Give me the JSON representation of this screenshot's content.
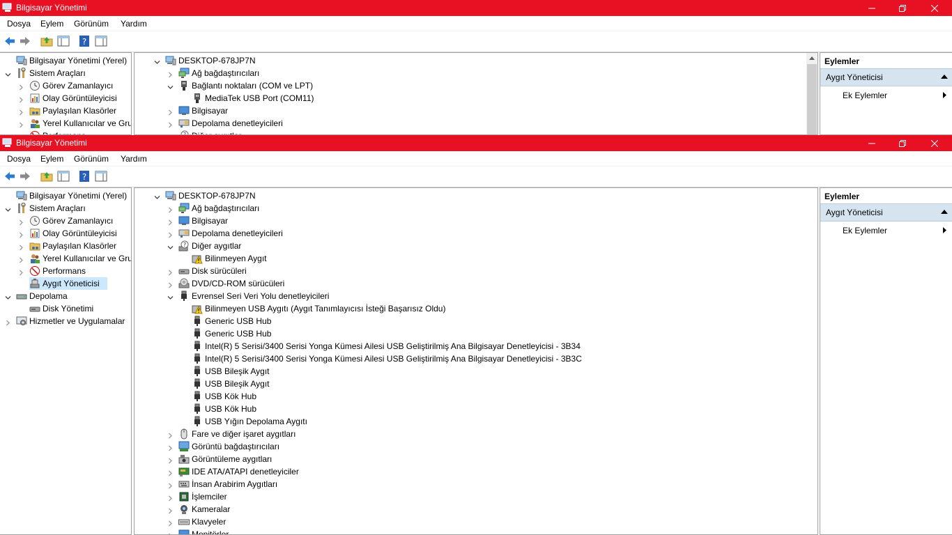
{
  "window_title": "Bilgisayar Yönetimi",
  "menu": [
    "Dosya",
    "Eylem",
    "Görünüm",
    "Yardım"
  ],
  "toolbar_icons": [
    "back-icon",
    "forward-icon",
    "up-folder-icon",
    "show-hide-tree-icon",
    "help-icon",
    "properties-icon"
  ],
  "colors": {
    "titlebar": "#e81123",
    "selection": "#cce8ff",
    "actions_band": "#d6e4f0"
  },
  "window1": {
    "left_tree": [
      {
        "label": "Bilgisayar Yönetimi (Yerel)",
        "icon": "computer-management-icon",
        "level": 0,
        "expander": "none"
      },
      {
        "label": "Sistem Araçları",
        "icon": "tools-icon",
        "level": 0,
        "expander": "expanded"
      },
      {
        "label": "Görev Zamanlayıcı",
        "icon": "clock-icon",
        "level": 1,
        "expander": "collapsed"
      },
      {
        "label": "Olay Görüntüleyicisi",
        "icon": "event-viewer-icon",
        "level": 1,
        "expander": "collapsed"
      },
      {
        "label": "Paylaşılan Klasörler",
        "icon": "shared-folder-icon",
        "level": 1,
        "expander": "collapsed"
      },
      {
        "label": "Yerel Kullanıcılar ve Gru",
        "icon": "users-icon",
        "level": 1,
        "expander": "collapsed"
      },
      {
        "label": "Performans",
        "icon": "performance-icon",
        "level": 1,
        "expander": "collapsed"
      }
    ],
    "device_tree": [
      {
        "label": "DESKTOP-678JP7N",
        "icon": "computer-icon",
        "level": 0,
        "expander": "expanded"
      },
      {
        "label": "Ağ bağdaştırıcıları",
        "icon": "network-icon",
        "level": 1,
        "expander": "collapsed"
      },
      {
        "label": "Bağlantı noktaları (COM ve LPT)",
        "icon": "port-icon",
        "level": 1,
        "expander": "expanded"
      },
      {
        "label": "MediaTek USB Port (COM11)",
        "icon": "port-icon",
        "level": 2,
        "expander": "none"
      },
      {
        "label": "Bilgisayar",
        "icon": "monitor-icon",
        "level": 1,
        "expander": "collapsed"
      },
      {
        "label": "Depolama denetleyicileri",
        "icon": "storage-controller-icon",
        "level": 1,
        "expander": "collapsed"
      },
      {
        "label": "Diğer aygıtlar",
        "icon": "other-devices-icon",
        "level": 1,
        "expander": "collapsed"
      }
    ]
  },
  "window2": {
    "left_tree": [
      {
        "label": "Bilgisayar Yönetimi (Yerel)",
        "icon": "computer-management-icon",
        "level": 0,
        "expander": "none"
      },
      {
        "label": "Sistem Araçları",
        "icon": "tools-icon",
        "level": 0,
        "expander": "expanded"
      },
      {
        "label": "Görev Zamanlayıcı",
        "icon": "clock-icon",
        "level": 1,
        "expander": "collapsed"
      },
      {
        "label": "Olay Görüntüleyicisi",
        "icon": "event-viewer-icon",
        "level": 1,
        "expander": "collapsed"
      },
      {
        "label": "Paylaşılan Klasörler",
        "icon": "shared-folder-icon",
        "level": 1,
        "expander": "collapsed"
      },
      {
        "label": "Yerel Kullanıcılar ve Gru",
        "icon": "users-icon",
        "level": 1,
        "expander": "collapsed"
      },
      {
        "label": "Performans",
        "icon": "performance-icon",
        "level": 1,
        "expander": "collapsed"
      },
      {
        "label": "Aygıt Yöneticisi",
        "icon": "device-manager-icon",
        "level": 1,
        "expander": "none",
        "selected": true
      },
      {
        "label": "Depolama",
        "icon": "storage-icon",
        "level": 0,
        "expander": "expanded"
      },
      {
        "label": "Disk Yönetimi",
        "icon": "disk-icon",
        "level": 1,
        "expander": "none"
      },
      {
        "label": "Hizmetler ve Uygulamalar",
        "icon": "services-icon",
        "level": 0,
        "expander": "collapsed"
      }
    ],
    "device_tree": [
      {
        "label": "DESKTOP-678JP7N",
        "icon": "computer-icon",
        "level": 0,
        "expander": "expanded"
      },
      {
        "label": "Ağ bağdaştırıcıları",
        "icon": "network-icon",
        "level": 1,
        "expander": "collapsed"
      },
      {
        "label": "Bilgisayar",
        "icon": "monitor-icon",
        "level": 1,
        "expander": "collapsed"
      },
      {
        "label": "Depolama denetleyicileri",
        "icon": "storage-controller-icon",
        "level": 1,
        "expander": "collapsed"
      },
      {
        "label": "Diğer aygıtlar",
        "icon": "other-devices-icon",
        "level": 1,
        "expander": "expanded"
      },
      {
        "label": "Bilinmeyen Aygıt",
        "icon": "warning-device-icon",
        "level": 2,
        "expander": "none"
      },
      {
        "label": "Disk sürücüleri",
        "icon": "disk-icon",
        "level": 1,
        "expander": "collapsed"
      },
      {
        "label": "DVD/CD-ROM sürücüleri",
        "icon": "dvd-icon",
        "level": 1,
        "expander": "collapsed"
      },
      {
        "label": "Evrensel Seri Veri Yolu denetleyicileri",
        "icon": "usb-icon",
        "level": 1,
        "expander": "expanded"
      },
      {
        "label": "Bilinmeyen USB Aygıtı (Aygıt Tanımlayıcısı İsteği Başarısız Oldu)",
        "icon": "warning-device-icon",
        "level": 2,
        "expander": "none"
      },
      {
        "label": "Generic USB Hub",
        "icon": "usb-icon",
        "level": 2,
        "expander": "none"
      },
      {
        "label": "Generic USB Hub",
        "icon": "usb-icon",
        "level": 2,
        "expander": "none"
      },
      {
        "label": "Intel(R) 5 Serisi/3400 Serisi Yonga Kümesi Ailesi USB Geliştirilmiş Ana Bilgisayar Denetleyicisi - 3B34",
        "icon": "usb-icon",
        "level": 2,
        "expander": "none"
      },
      {
        "label": "Intel(R) 5 Serisi/3400 Serisi Yonga Kümesi Ailesi USB Geliştirilmiş Ana Bilgisayar Denetleyicisi - 3B3C",
        "icon": "usb-icon",
        "level": 2,
        "expander": "none"
      },
      {
        "label": "USB Bileşik Aygıt",
        "icon": "usb-icon",
        "level": 2,
        "expander": "none"
      },
      {
        "label": "USB Bileşik Aygıt",
        "icon": "usb-icon",
        "level": 2,
        "expander": "none"
      },
      {
        "label": "USB Kök Hub",
        "icon": "usb-icon",
        "level": 2,
        "expander": "none"
      },
      {
        "label": "USB Kök Hub",
        "icon": "usb-icon",
        "level": 2,
        "expander": "none"
      },
      {
        "label": "USB Yığın Depolama Aygıtı",
        "icon": "usb-icon",
        "level": 2,
        "expander": "none"
      },
      {
        "label": "Fare ve diğer işaret aygıtları",
        "icon": "mouse-icon",
        "level": 1,
        "expander": "collapsed"
      },
      {
        "label": "Görüntü bağdaştırıcıları",
        "icon": "display-adapter-icon",
        "level": 1,
        "expander": "collapsed"
      },
      {
        "label": "Görüntüleme aygıtları",
        "icon": "imaging-icon",
        "level": 1,
        "expander": "collapsed"
      },
      {
        "label": "IDE ATA/ATAPI denetleyiciler",
        "icon": "ide-icon",
        "level": 1,
        "expander": "collapsed"
      },
      {
        "label": "İnsan Arabirim Aygıtları",
        "icon": "hid-icon",
        "level": 1,
        "expander": "collapsed"
      },
      {
        "label": "İşlemciler",
        "icon": "processor-icon",
        "level": 1,
        "expander": "collapsed"
      },
      {
        "label": "Kameralar",
        "icon": "camera-icon",
        "level": 1,
        "expander": "collapsed"
      },
      {
        "label": "Klavyeler",
        "icon": "keyboard-icon",
        "level": 1,
        "expander": "collapsed"
      },
      {
        "label": "Monitörler",
        "icon": "monitor-icon",
        "level": 1,
        "expander": "collapsed"
      }
    ]
  },
  "actions": {
    "header": "Eylemler",
    "section": "Aygıt Yöneticisi",
    "sub": "Ek Eylemler"
  }
}
